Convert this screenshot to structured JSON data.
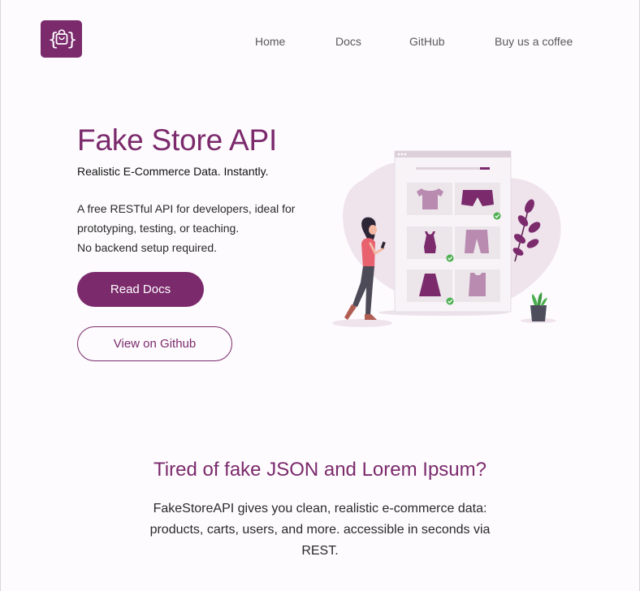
{
  "brand": {
    "logo_icon": "shopping-bag-braces-icon",
    "accent": "#7b2a6c"
  },
  "nav": {
    "items": [
      {
        "label": "Home"
      },
      {
        "label": "Docs"
      },
      {
        "label": "GitHub"
      },
      {
        "label": "Buy us a coffee"
      }
    ]
  },
  "hero": {
    "title": "Fake Store API",
    "subtitle": "Realistic E-Commerce Data. Instantly.",
    "description_lines": [
      "A free RESTful API for developers, ideal for",
      "prototyping, testing, or teaching.",
      "No backend setup required."
    ],
    "primary_button": "Read Docs",
    "secondary_button": "View on Github",
    "illustration_icon": "online-shopping-illustration"
  },
  "intro": {
    "title": "Tired of fake JSON and Lorem Ipsum?",
    "body_lines": [
      "FakeStoreAPI gives you clean, realistic e-commerce data:",
      "products, carts, users, and more. accessible in seconds via",
      "REST."
    ]
  }
}
